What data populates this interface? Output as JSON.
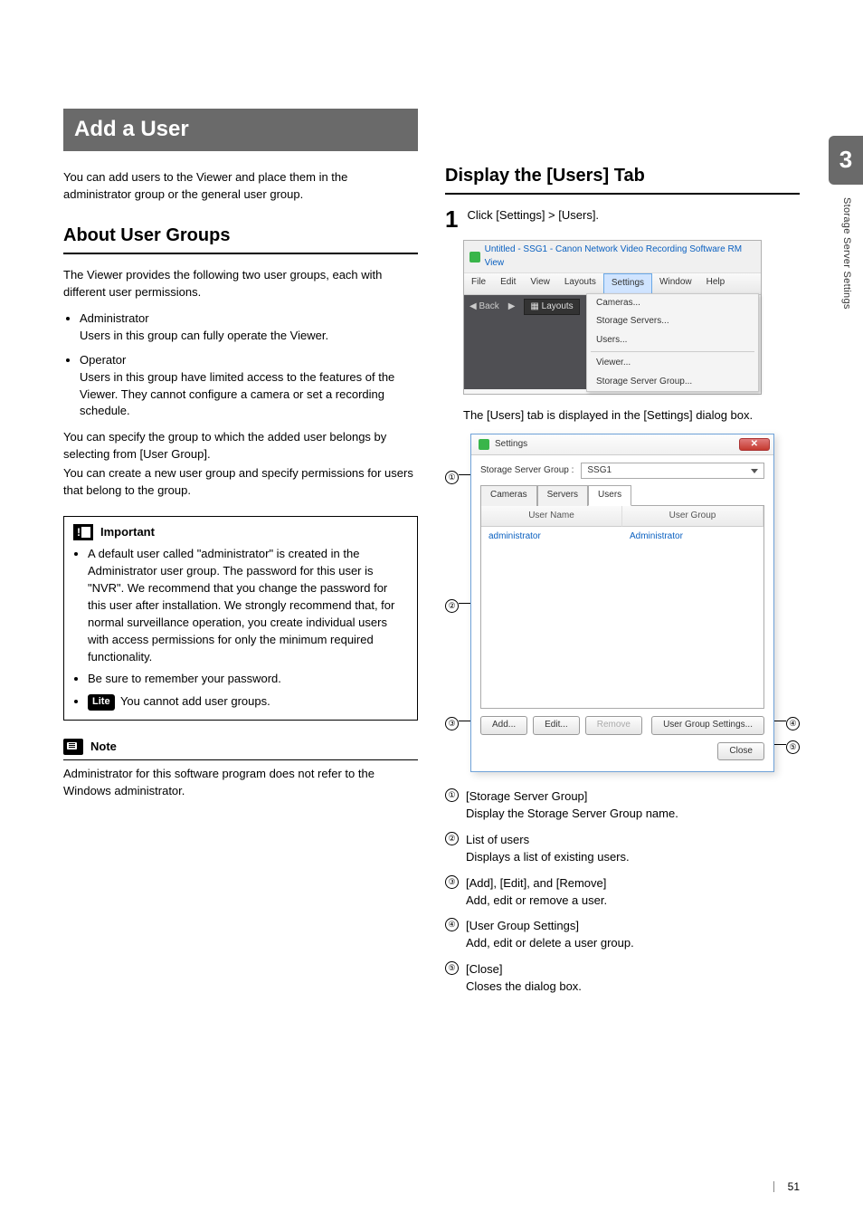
{
  "h1": "Add a User",
  "left": {
    "intro": "You can add users to the Viewer and place them in the administrator group or the general user group.",
    "h2": "About User Groups",
    "p1": "The Viewer provides the following two user groups, each with different user permissions.",
    "groups": [
      {
        "name": "Administrator",
        "desc": "Users in this group can fully operate the Viewer."
      },
      {
        "name": "Operator",
        "desc": "Users in this group have limited access to the features of the Viewer. They cannot configure a camera or set a recording schedule."
      }
    ],
    "p2": "You can specify the group to which the added user belongs by selecting from [User Group].",
    "p3": "You can create a new user group and specify permissions for users that belong to the group.",
    "important_label": "Important",
    "important": [
      "A default user called \"administrator\" is created in the Administrator user group. The password for this user is \"NVR\". We recommend that you change the password for this user after installation. We strongly recommend that, for normal surveillance operation, you create individual users with access permissions for only the minimum required functionality.",
      "Be sure to remember your password."
    ],
    "important_lite_badge": "Lite",
    "important_lite_text": " You cannot add user groups.",
    "note_label": "Note",
    "note_text": "Administrator for this software program does not refer to the Windows administrator."
  },
  "right": {
    "h2": "Display the [Users] Tab",
    "step1_num": "1",
    "step1_text": "Click [Settings] > [Users].",
    "shot1": {
      "title": "Untitled - SSG1 - Canon Network Video Recording Software RM View",
      "menubar": [
        "File",
        "Edit",
        "View",
        "Layouts",
        "Settings",
        "Window",
        "Help"
      ],
      "menubar_active": "Settings",
      "toolbar_back": "◀ Back",
      "toolbar_fwd": "▶",
      "toolbar_layouts": "▦  Layouts",
      "dropdown": [
        "Cameras...",
        "Storage Servers...",
        "Users...",
        "—",
        "Viewer...",
        "Storage Server Group..."
      ]
    },
    "step1_result": "The [Users] tab is displayed in the [Settings] dialog box.",
    "shot2": {
      "title": "Settings",
      "ssg_label": "Storage Server Group :",
      "ssg_value": "SSG1",
      "tabs": [
        "Cameras",
        "Servers",
        "Users"
      ],
      "tabs_active": "Users",
      "thead": [
        "User Name",
        "User Group"
      ],
      "trow": [
        "administrator",
        "Administrator"
      ],
      "btn_add": "Add...",
      "btn_edit": "Edit...",
      "btn_remove": "Remove",
      "btn_ug": "User Group Settings...",
      "btn_close": "Close"
    },
    "legend": [
      {
        "n": "1",
        "title": "[Storage Server Group]",
        "desc": "Display the Storage Server Group name."
      },
      {
        "n": "2",
        "title": "List of users",
        "desc": "Displays a list of existing users."
      },
      {
        "n": "3",
        "title": "[Add], [Edit], and [Remove]",
        "desc": "Add, edit or remove a user."
      },
      {
        "n": "4",
        "title": "[User Group Settings]",
        "desc": "Add, edit or delete a user group."
      },
      {
        "n": "5",
        "title": "[Close]",
        "desc": "Closes the dialog box."
      }
    ]
  },
  "side": {
    "chapter": "3",
    "label": "Storage Server Settings"
  },
  "pagenum": "51"
}
